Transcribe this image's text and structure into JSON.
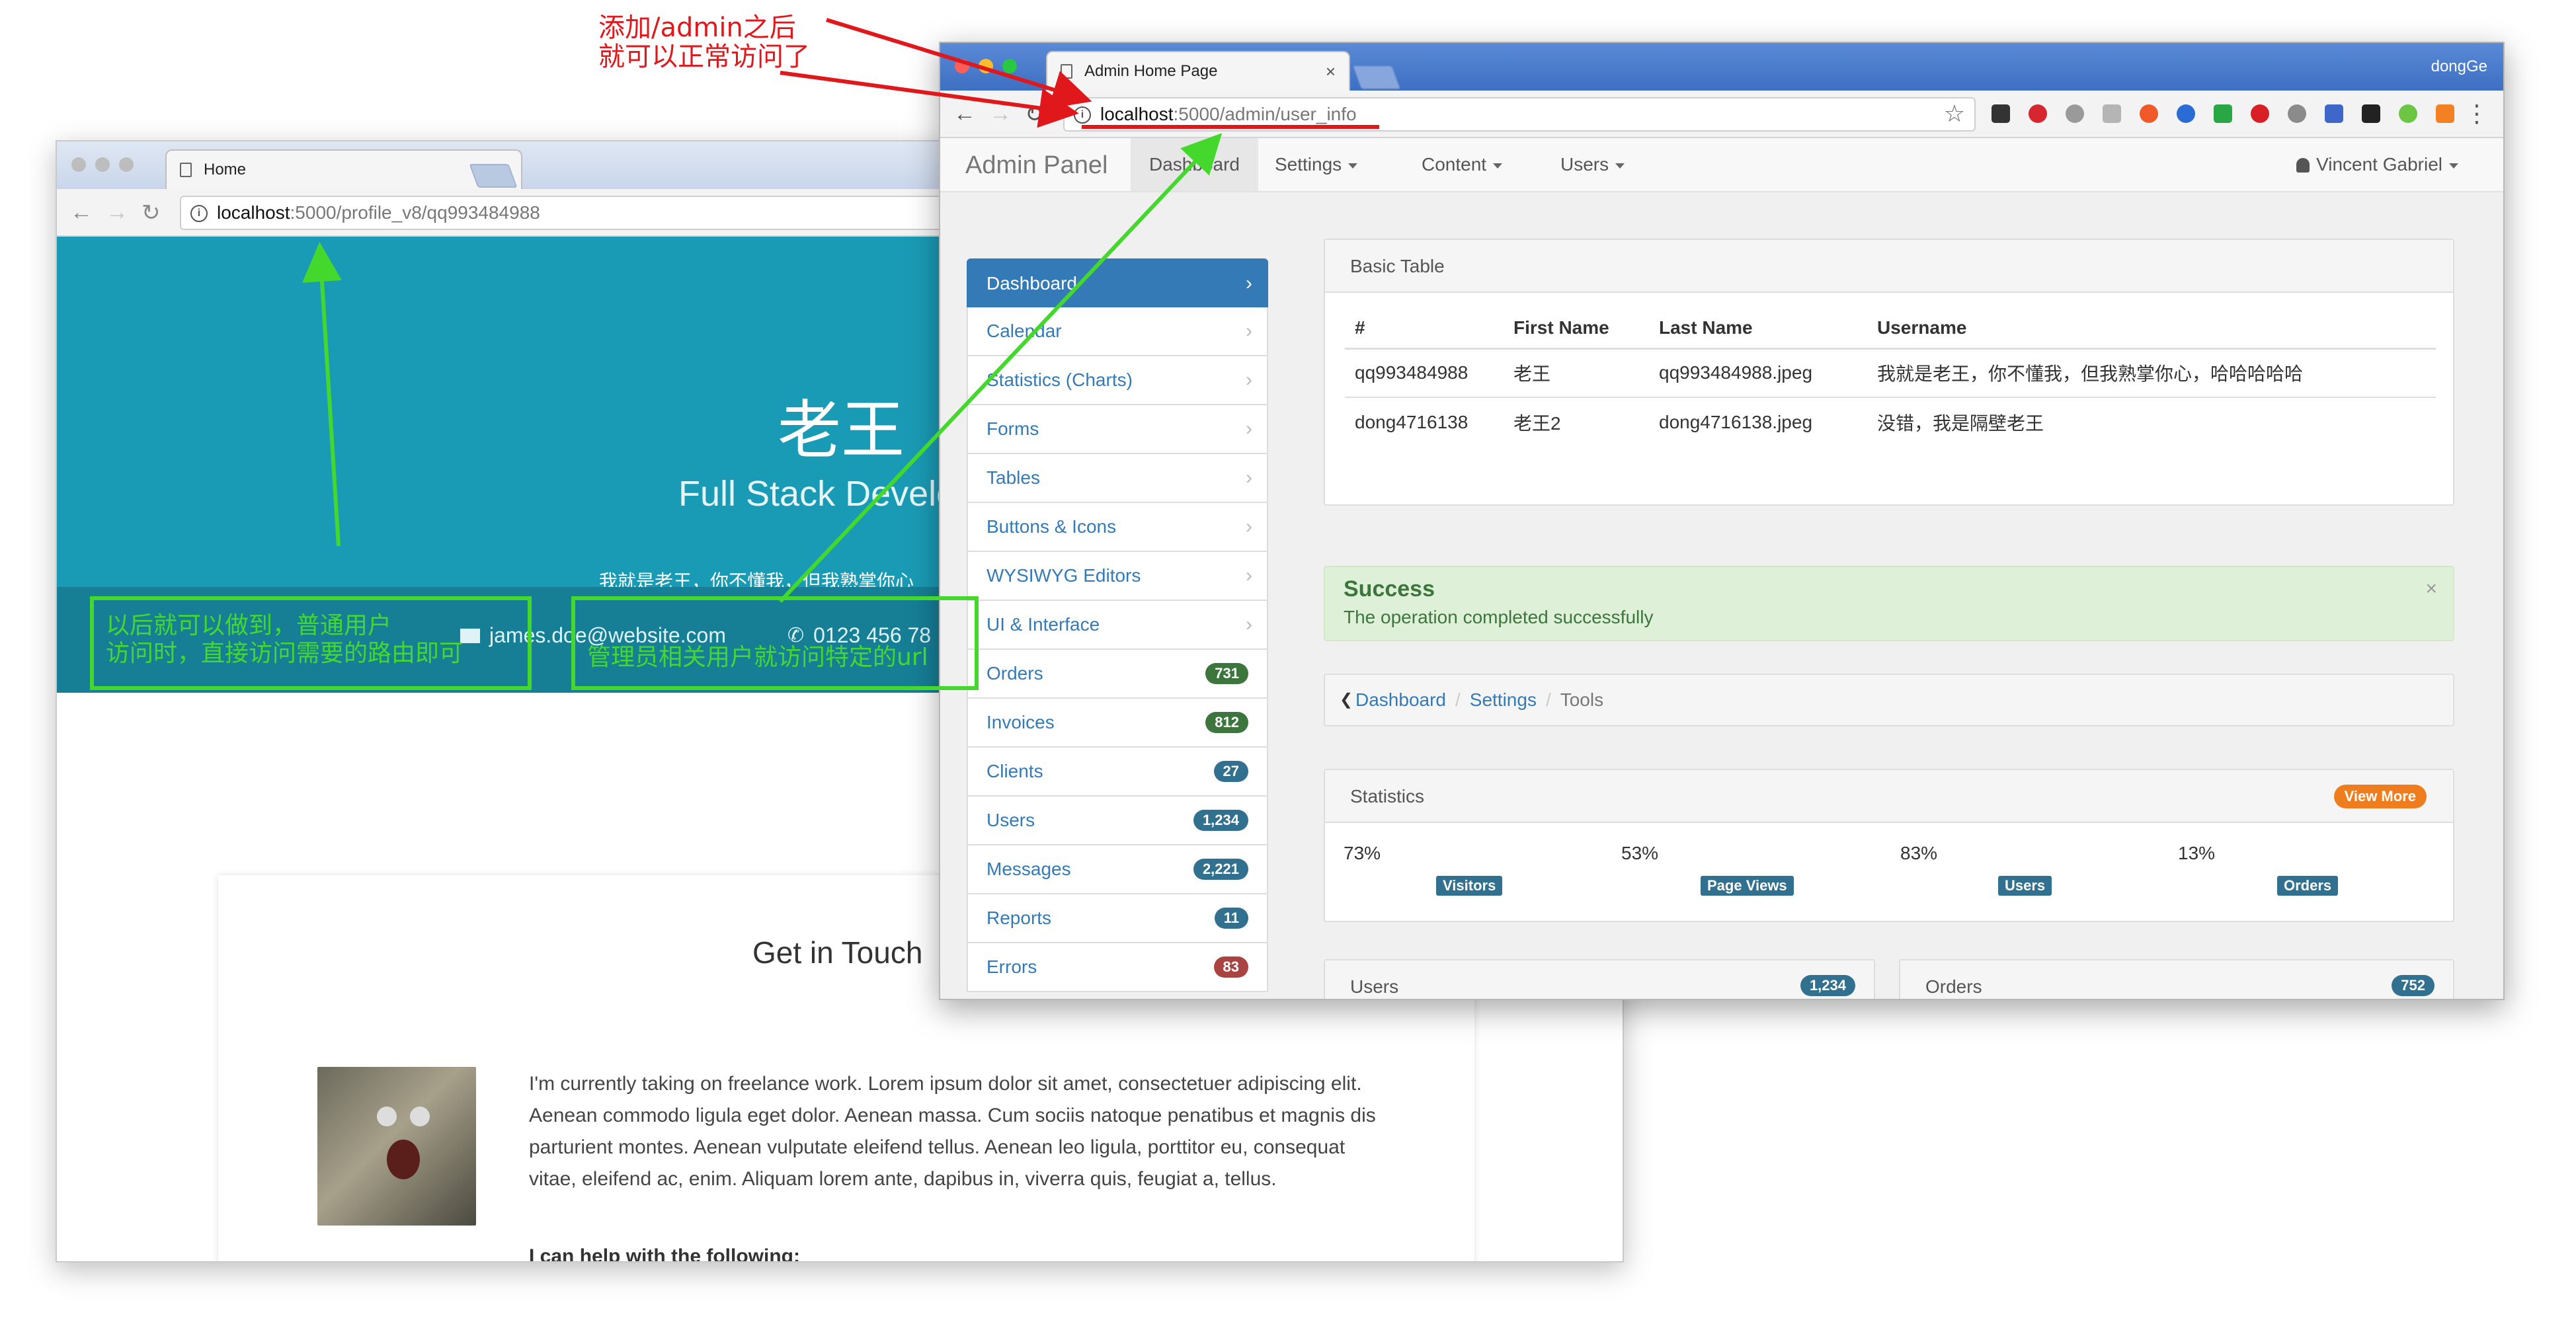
{
  "back_window": {
    "tab_title": "Home",
    "url_host": "localhost",
    "url_path": ":5000/profile_v8/qq993484988",
    "hero": {
      "name": "老王",
      "role": "Full Stack Develo",
      "bio": "我就是老王，你不懂我，但我熟掌你心",
      "email": "james.doe@website.com",
      "phone": "0123 456 78"
    },
    "card": {
      "title": "Get in Touch",
      "text": "I'm currently taking on freelance work. Lorem ipsum dolor sit amet, consectetuer adipiscing elit. Aenean commodo ligula eget dolor. Aenean massa. Cum sociis natoque penatibus et magnis dis parturient montes. Aenean vulputate eleifend tellus. Aenean leo ligula, porttitor eu, consequat vitae, eleifend ac, enim. Aliquam lorem ante, dapibus in, viverra quis, feugiat a, tellus.",
      "bold_line": "I can help with the following:"
    }
  },
  "front_window": {
    "tab_title": "Admin Home Page",
    "profile_name": "dongGe",
    "url_host": "localhost",
    "url_path": ":5000/admin/user_info",
    "navbar": {
      "brand": "Admin Panel",
      "items": [
        "Dashboard",
        "Settings",
        "Content",
        "Users"
      ],
      "user": "Vincent Gabriel"
    },
    "sidebar": [
      {
        "label": "Dashboard"
      },
      {
        "label": "Calendar"
      },
      {
        "label": "Statistics (Charts)"
      },
      {
        "label": "Forms"
      },
      {
        "label": "Tables"
      },
      {
        "label": "Buttons & Icons"
      },
      {
        "label": "WYSIWYG Editors"
      },
      {
        "label": "UI & Interface"
      },
      {
        "label": "Orders",
        "badge": "731",
        "color": "#3c763d"
      },
      {
        "label": "Invoices",
        "badge": "812",
        "color": "#3c763d"
      },
      {
        "label": "Clients",
        "badge": "27",
        "color": "#31708f"
      },
      {
        "label": "Users",
        "badge": "1,234",
        "color": "#31708f"
      },
      {
        "label": "Messages",
        "badge": "2,221",
        "color": "#31708f"
      },
      {
        "label": "Reports",
        "badge": "11",
        "color": "#31708f"
      },
      {
        "label": "Errors",
        "badge": "83",
        "color": "#a94442"
      }
    ],
    "basic_table": {
      "title": "Basic Table",
      "headers": [
        "#",
        "First Name",
        "Last Name",
        "Username"
      ],
      "rows": [
        [
          "qq993484988",
          "老王",
          "qq993484988.jpeg",
          "我就是老王，你不懂我，但我熟掌你心，哈哈哈哈哈"
        ],
        [
          "dong4716138",
          "老王2",
          "dong4716138.jpeg",
          "没错，我是隔壁老王"
        ]
      ]
    },
    "alert": {
      "title": "Success",
      "text": "The operation completed successfully",
      "close": "×"
    },
    "breadcrumb": [
      "Dashboard",
      "Settings",
      "Tools"
    ],
    "statistics": {
      "title": "Statistics",
      "view_more": "View More",
      "items": [
        {
          "value": "73%",
          "label": "Visitors"
        },
        {
          "value": "53%",
          "label": "Page Views"
        },
        {
          "value": "83%",
          "label": "Users"
        },
        {
          "value": "13%",
          "label": "Orders"
        }
      ]
    },
    "users_panel": {
      "title": "Users",
      "badge": "1,234"
    },
    "orders_panel": {
      "title": "Orders",
      "badge": "752"
    }
  },
  "annotations": {
    "red_note": [
      "添加/admin之后",
      "就可以正常访问了"
    ],
    "green_left": [
      "以后就可以做到，普通用户",
      "访问时，直接访问需要的路由即可"
    ],
    "green_right": "管理员相关用户就访问特定的url"
  },
  "colors": {
    "primary": "#337ab7",
    "hero": "#1a9bb5",
    "success_bg": "#dff0d8",
    "annotation_red": "#e0181b",
    "annotation_green": "#44d82d"
  }
}
